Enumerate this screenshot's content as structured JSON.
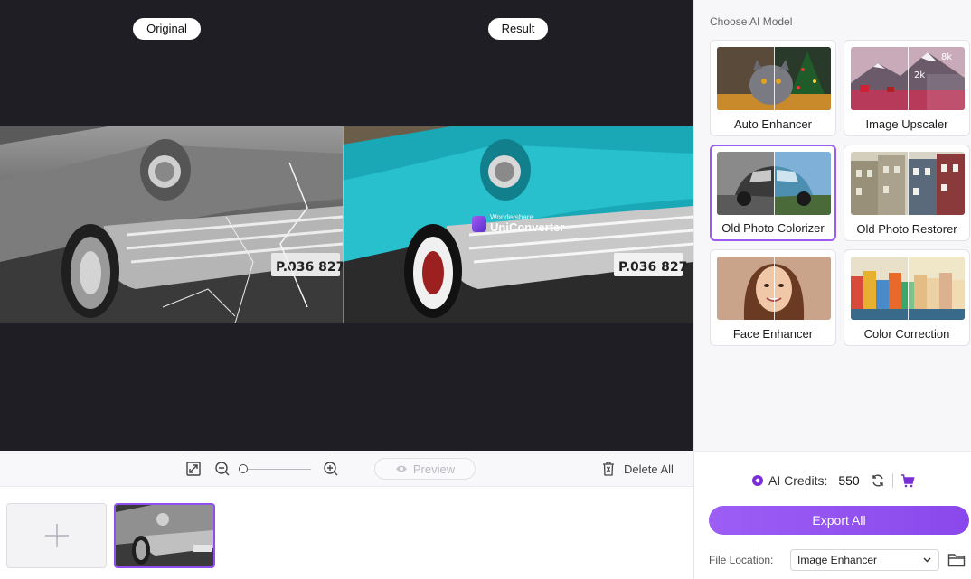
{
  "preview": {
    "original_label": "Original",
    "result_label": "Result",
    "watermark_small": "Wondershare",
    "watermark_big": "UniConverter",
    "plate_text": "P.036 827"
  },
  "toolbar": {
    "preview_label": "Preview",
    "delete_all_label": "Delete All",
    "zoom_level": 0
  },
  "side": {
    "title": "Choose AI Model",
    "models": [
      {
        "label": "Auto Enhancer",
        "icon": "cat-christmas-thumbnail",
        "selected": false
      },
      {
        "label": "Image Upscaler",
        "icon": "snow-mountain-thumbnail",
        "selected": false
      },
      {
        "label": "Old Photo Colorizer",
        "icon": "beetle-car-thumbnail",
        "selected": true
      },
      {
        "label": "Old Photo Restorer",
        "icon": "houses-thumbnail",
        "selected": false
      },
      {
        "label": "Face Enhancer",
        "icon": "woman-face-thumbnail",
        "selected": false
      },
      {
        "label": "Color Correction",
        "icon": "colorful-town-thumbnail",
        "selected": false
      }
    ],
    "upscale_badges": [
      "8k",
      "2k"
    ],
    "credits_label": "AI Credits:",
    "credits_value": "550",
    "export_label": "Export All",
    "file_location_label": "File Location:",
    "file_location_value": "Image Enhancer"
  },
  "colors": {
    "accent": "#8f4ef0",
    "preview_bg": "#1e1e24",
    "car_teal": "#19a9b8"
  }
}
